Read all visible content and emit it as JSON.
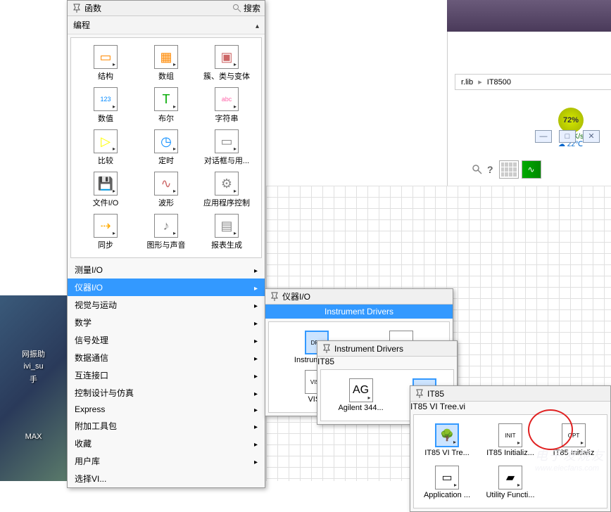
{
  "desktop": {
    "icon1": "网振助",
    "icon2": "ivi_su",
    "icon3": "手",
    "icon4": "MAX"
  },
  "window": {
    "breadcrumb_lib": "r.lib",
    "breadcrumb_folder": "IT8500",
    "speed_up": "1.0K/s",
    "temp": "22℃",
    "percent": "72%"
  },
  "palette": {
    "title": "函数",
    "search": "搜索",
    "category_programming": "编程",
    "icons": [
      {
        "label": "结构",
        "glyph": "▭"
      },
      {
        "label": "数组",
        "glyph": "▦"
      },
      {
        "label": "簇、类与变体",
        "glyph": "▣"
      },
      {
        "label": "数值",
        "glyph": "123"
      },
      {
        "label": "布尔",
        "glyph": "T"
      },
      {
        "label": "字符串",
        "glyph": "abc"
      },
      {
        "label": "比较",
        "glyph": "▷"
      },
      {
        "label": "定时",
        "glyph": "◷"
      },
      {
        "label": "对话框与用...",
        "glyph": "▭"
      },
      {
        "label": "文件I/O",
        "glyph": "💾"
      },
      {
        "label": "波形",
        "glyph": "∿"
      },
      {
        "label": "应用程序控制",
        "glyph": "⚙"
      },
      {
        "label": "同步",
        "glyph": "⇢"
      },
      {
        "label": "图形与声音",
        "glyph": "♪"
      },
      {
        "label": "报表生成",
        "glyph": "▤"
      }
    ],
    "menu": [
      {
        "label": "测量I/O",
        "arrow": true
      },
      {
        "label": "仪器I/O",
        "arrow": true,
        "selected": true
      },
      {
        "label": "视觉与运动",
        "arrow": true
      },
      {
        "label": "数学",
        "arrow": true
      },
      {
        "label": "信号处理",
        "arrow": true
      },
      {
        "label": "数据通信",
        "arrow": true
      },
      {
        "label": "互连接口",
        "arrow": true
      },
      {
        "label": "控制设计与仿真",
        "arrow": true
      },
      {
        "label": "Express",
        "arrow": true
      },
      {
        "label": "附加工具包",
        "arrow": true
      },
      {
        "label": "收藏",
        "arrow": true
      },
      {
        "label": "用户库",
        "arrow": true
      },
      {
        "label": "选择VI...",
        "arrow": false
      }
    ]
  },
  "submenu1": {
    "title": "仪器I/O",
    "selected": "Instrument Drivers",
    "items": [
      {
        "label": "Instrument ...",
        "glyph": "DRV"
      },
      {
        "label": "",
        "glyph": "▭"
      },
      {
        "label": "VISA",
        "glyph": "VISA"
      }
    ]
  },
  "submenu2": {
    "title": "Instrument Drivers",
    "selected": "IT85",
    "items": [
      {
        "label": "Agilent 344...",
        "glyph": "AG"
      },
      {
        "label": "IT85",
        "glyph": "IT85"
      }
    ]
  },
  "submenu3": {
    "title": "IT85",
    "selected": "IT85 VI Tree.vi",
    "items": [
      {
        "label": "IT85 VI Tre...",
        "glyph": "🌳"
      },
      {
        "label": "IT85 Initializ...",
        "glyph": "INIT"
      },
      {
        "label": "IT85 Initializ",
        "glyph": "OPT"
      },
      {
        "label": "Application ...",
        "glyph": "▭"
      },
      {
        "label": "Utility Functi...",
        "glyph": "▰"
      }
    ]
  },
  "watermark": {
    "cn": "电子发烧友",
    "url": "www.elecfans.com"
  }
}
